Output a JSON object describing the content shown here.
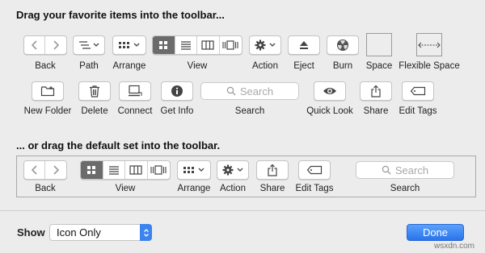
{
  "headings": {
    "favorites": "Drag your favorite items into the toolbar...",
    "default_set": "... or drag the default set into the toolbar."
  },
  "items_row1": {
    "back": "Back",
    "path": "Path",
    "arrange": "Arrange",
    "view": "View",
    "action": "Action",
    "eject": "Eject",
    "burn": "Burn",
    "space": "Space",
    "flexible_space": "Flexible Space"
  },
  "items_row2": {
    "new_folder": "New Folder",
    "delete": "Delete",
    "connect": "Connect",
    "get_info": "Get Info",
    "search": "Search",
    "search_placeholder": "Search",
    "quick_look": "Quick Look",
    "share": "Share",
    "edit_tags": "Edit Tags"
  },
  "default_set": {
    "back": "Back",
    "view": "View",
    "arrange": "Arrange",
    "action": "Action",
    "share": "Share",
    "edit_tags": "Edit Tags",
    "search": "Search",
    "search_placeholder": "Search"
  },
  "footer": {
    "show_label": "Show",
    "show_value": "Icon Only",
    "done_label": "Done"
  },
  "watermark": "wsxdn.com",
  "icons": {
    "back": "chevron-left-icon",
    "forward": "chevron-right-icon",
    "path": "path-icon",
    "arrange": "arrange-grid-icon",
    "view_icons": "grid-icon",
    "view_list": "list-icon",
    "view_columns": "columns-icon",
    "view_cover": "cover-flow-icon",
    "action": "gear-icon",
    "eject": "eject-icon",
    "burn": "radiation-icon",
    "new_folder": "new-folder-icon",
    "delete": "trash-icon",
    "connect": "computer-icon",
    "get_info": "info-icon",
    "search": "magnifier-icon",
    "quick_look": "eye-icon",
    "share": "share-icon",
    "edit_tags": "tag-icon"
  },
  "colors": {
    "background": "#ececec",
    "selected_segment": "#6b6b6b",
    "accent": "#2a74ec"
  }
}
